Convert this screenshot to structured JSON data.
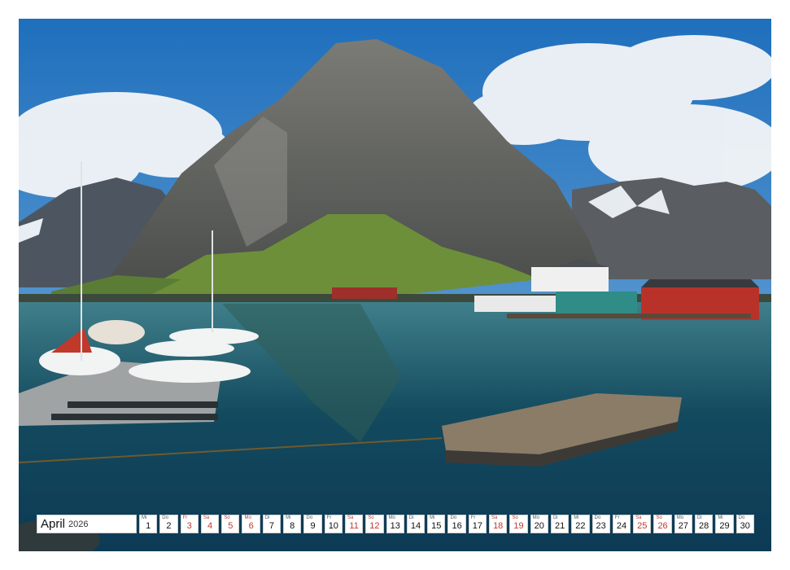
{
  "photo": {
    "subject": "",
    "colors": {
      "sky": "#2f7fc6",
      "water": "#13465c",
      "rock": "#6b6b66",
      "house_red": "#b8322a"
    }
  },
  "calendar": {
    "month": "April",
    "year": "2026",
    "days": [
      {
        "n": "1",
        "wd": "Mi",
        "red": false
      },
      {
        "n": "2",
        "wd": "Do",
        "red": false
      },
      {
        "n": "3",
        "wd": "Fr",
        "red": true
      },
      {
        "n": "4",
        "wd": "Sa",
        "red": true
      },
      {
        "n": "5",
        "wd": "So",
        "red": true
      },
      {
        "n": "6",
        "wd": "Mo",
        "red": true
      },
      {
        "n": "7",
        "wd": "Di",
        "red": false
      },
      {
        "n": "8",
        "wd": "Mi",
        "red": false
      },
      {
        "n": "9",
        "wd": "Do",
        "red": false
      },
      {
        "n": "10",
        "wd": "Fr",
        "red": false
      },
      {
        "n": "11",
        "wd": "Sa",
        "red": true
      },
      {
        "n": "12",
        "wd": "So",
        "red": true
      },
      {
        "n": "13",
        "wd": "Mo",
        "red": false
      },
      {
        "n": "14",
        "wd": "Di",
        "red": false
      },
      {
        "n": "15",
        "wd": "Mi",
        "red": false
      },
      {
        "n": "16",
        "wd": "Do",
        "red": false
      },
      {
        "n": "17",
        "wd": "Fr",
        "red": false
      },
      {
        "n": "18",
        "wd": "Sa",
        "red": true
      },
      {
        "n": "19",
        "wd": "So",
        "red": true
      },
      {
        "n": "20",
        "wd": "Mo",
        "red": false
      },
      {
        "n": "21",
        "wd": "Di",
        "red": false
      },
      {
        "n": "22",
        "wd": "Mi",
        "red": false
      },
      {
        "n": "23",
        "wd": "Do",
        "red": false
      },
      {
        "n": "24",
        "wd": "Fr",
        "red": false
      },
      {
        "n": "25",
        "wd": "Sa",
        "red": true
      },
      {
        "n": "26",
        "wd": "So",
        "red": true
      },
      {
        "n": "27",
        "wd": "Mo",
        "red": false
      },
      {
        "n": "28",
        "wd": "Di",
        "red": false
      },
      {
        "n": "29",
        "wd": "Mi",
        "red": false
      },
      {
        "n": "30",
        "wd": "Do",
        "red": false
      }
    ]
  }
}
